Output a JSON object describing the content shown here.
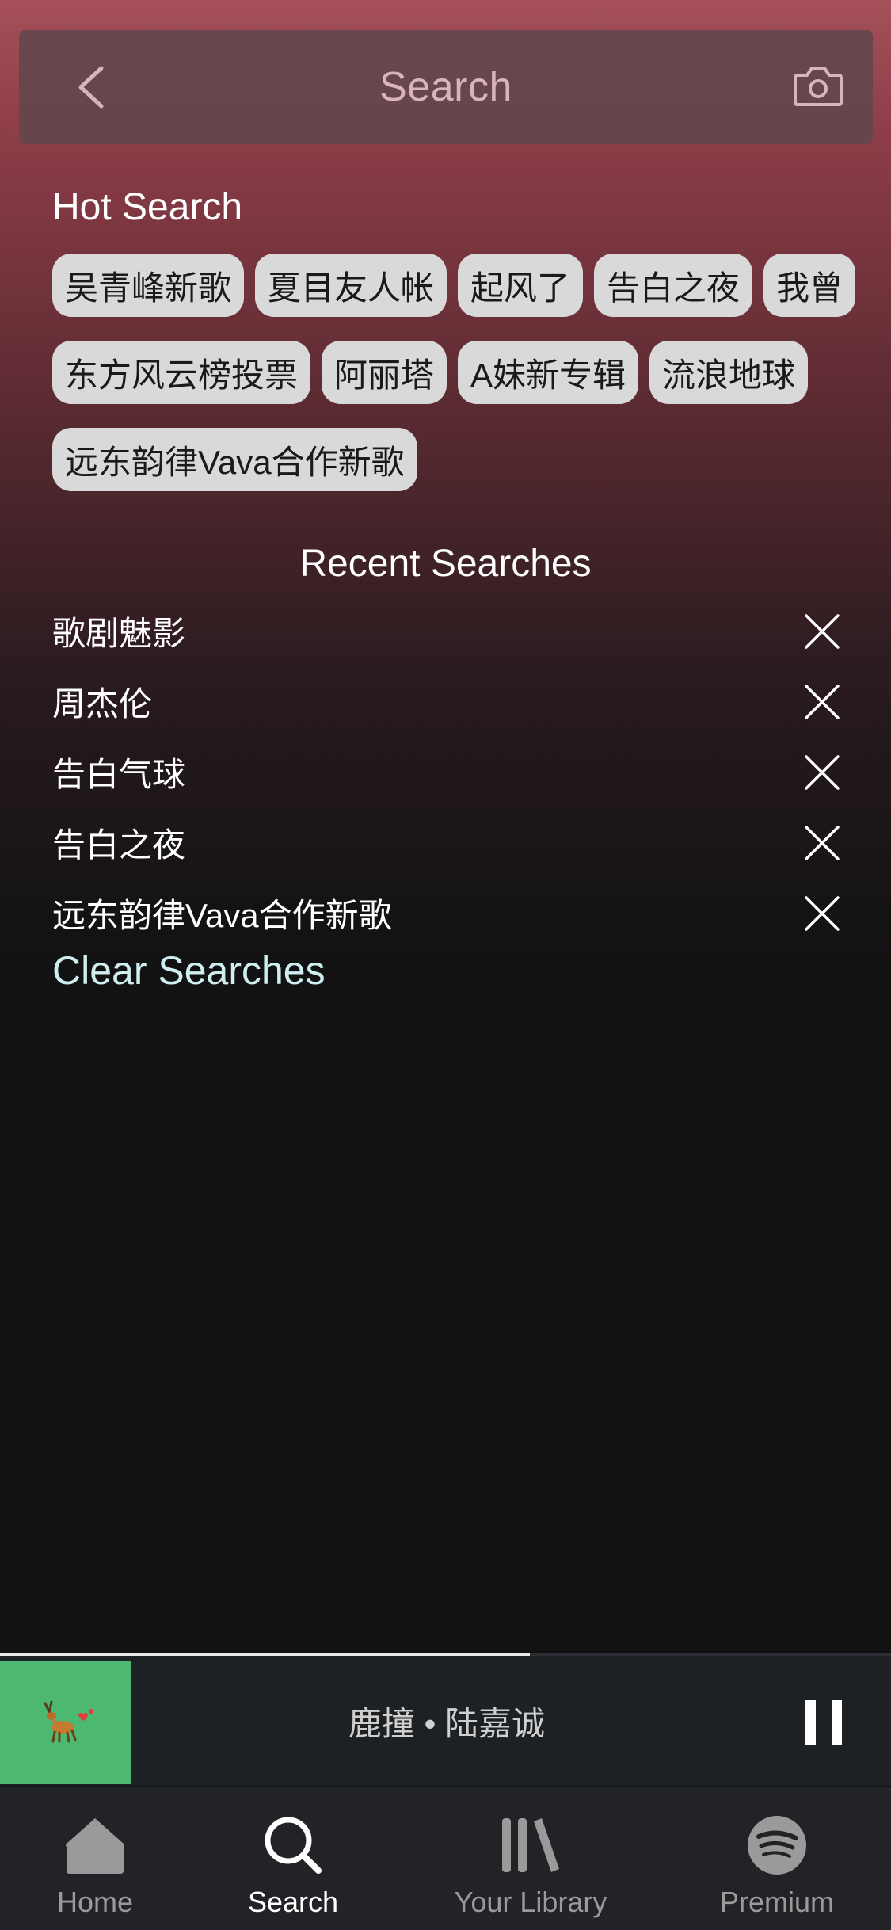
{
  "header": {
    "title": "Search",
    "back_icon": "chevron-left-icon",
    "camera_icon": "camera-icon"
  },
  "hot_search": {
    "title": "Hot Search",
    "tags": [
      "吴青峰新歌",
      "夏目友人帐",
      "起风了",
      "告白之夜",
      "我曾",
      "东方风云榜投票",
      "阿丽塔",
      "A妹新专辑",
      "流浪地球",
      "远东韵律Vava合作新歌"
    ]
  },
  "recent": {
    "title": "Recent Searches",
    "items": [
      "歌剧魅影",
      "周杰伦",
      "告白气球",
      "告白之夜",
      "远东韵律Vava合作新歌"
    ],
    "remove_icon": "close-icon",
    "clear_label": "Clear Searches"
  },
  "player": {
    "now_playing": "鹿撞 • 陆嘉诚",
    "progress": 0.595,
    "album_art_icon": "deer-icon",
    "pause_icon": "pause-icon"
  },
  "tabs": [
    {
      "label": "Home",
      "icon": "home-icon"
    },
    {
      "label": "Search",
      "icon": "search-icon",
      "active": true
    },
    {
      "label": "Your Library",
      "icon": "library-icon"
    },
    {
      "label": "Premium",
      "icon": "spotify-icon"
    }
  ],
  "colors": {
    "background_top": "#a5505a",
    "background_bottom": "#111111",
    "tag_background": "#d9d9d9",
    "clear_link": "#cfeef0",
    "album_art": "#4db871",
    "player_background": "#1e2124",
    "tabbar_background": "#212327"
  }
}
